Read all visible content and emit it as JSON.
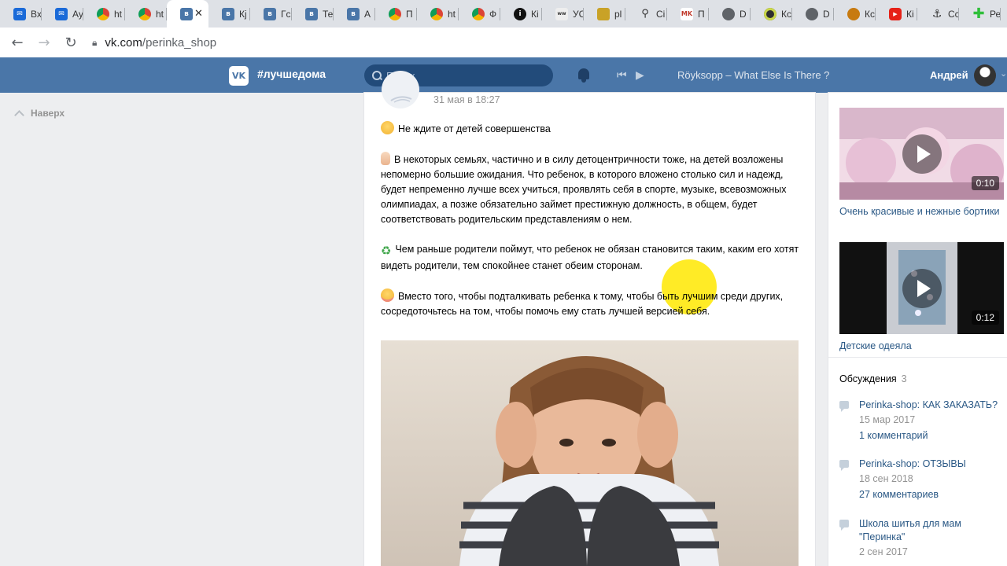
{
  "browser": {
    "tabs": [
      {
        "icon": "mail-icon",
        "title": "Вх",
        "color": "#1a6ad8"
      },
      {
        "icon": "mail-icon",
        "title": "Ау",
        "color": "#1a6ad8"
      },
      {
        "icon": "chrome-icon",
        "title": "ht",
        "color": "#e8a33d"
      },
      {
        "icon": "chrome-icon",
        "title": "ht",
        "color": "#e8a33d"
      },
      {
        "icon": "vk-icon",
        "title": "",
        "color": "#4a76a8",
        "active": true
      },
      {
        "icon": "vk-icon",
        "title": "Кј",
        "color": "#4a76a8"
      },
      {
        "icon": "vk-icon",
        "title": "Гс",
        "color": "#4a76a8"
      },
      {
        "icon": "vk-icon",
        "title": "Те",
        "color": "#4a76a8"
      },
      {
        "icon": "vk-icon",
        "title": "А",
        "color": "#4a76a8"
      },
      {
        "icon": "chrome-icon",
        "title": "П",
        "color": "#e8a33d"
      },
      {
        "icon": "chrome-icon",
        "title": "ht",
        "color": "#e8a33d"
      },
      {
        "icon": "chrome-icon",
        "title": "Ф",
        "color": "#e8a33d"
      },
      {
        "icon": "info-icon",
        "title": "Кі",
        "color": "#111111"
      },
      {
        "icon": "site-icon",
        "title": "УС",
        "color": "#555555"
      },
      {
        "icon": "site-icon",
        "title": "pl",
        "color": "#c9a227"
      },
      {
        "icon": "search-icon",
        "title": "Сі",
        "color": "#333333"
      },
      {
        "icon": "site-icon",
        "title": "П",
        "color": "#c0392b"
      },
      {
        "icon": "globe-icon",
        "title": "D",
        "color": "#5f6368"
      },
      {
        "icon": "site-icon",
        "title": "Кс",
        "color": "#2f2f2f"
      },
      {
        "icon": "globe-icon",
        "title": "D",
        "color": "#5f6368"
      },
      {
        "icon": "site-icon",
        "title": "Кс",
        "color": "#c77a10"
      },
      {
        "icon": "youtube-icon",
        "title": "Кі",
        "color": "#e62117"
      },
      {
        "icon": "anchor-icon",
        "title": "Сс",
        "color": "#333333"
      },
      {
        "icon": "plus-icon",
        "title": "Ре",
        "color": "#2fbf3a"
      }
    ],
    "active_close": "✕",
    "url_host": "vk.com",
    "url_path": "/perinka_shop"
  },
  "vk_header": {
    "logo": "VK",
    "hashtag": "#лучшедома",
    "search_placeholder": "Поиск",
    "track": "Röyksopp – What Else Is There ?",
    "user_name": "Андрей"
  },
  "left": {
    "back_to_top": "Наверх"
  },
  "post": {
    "date": "31 мая в 18:27",
    "paragraphs": [
      {
        "emoji": "face",
        "text": "Не ждите от детей совершенства"
      },
      {
        "emoji": "hand",
        "text": "В некоторых семьях, частично и в силу детоцентричности тоже, на детей возложены непомерно большие ожидания. Что ребенок, в которого вложено столько сил и надежд, будет непременно лучше всех учиться, проявлять себя в спорте, музыке, всевозможных олимпиадах, а позже обязательно займет престижную должность, в общем, будет соответствовать родительским представлениям о нем."
      },
      {
        "emoji": "recycle",
        "text": "Чем раньше родители поймут, что ребенок не обязан становится таким, каким его хотят видеть родители, тем спокойнее станет обеим сторонам."
      },
      {
        "emoji": "flushed",
        "text": "Вместо того, чтобы подталкивать ребенка к тому, чтобы быть лучшим среди других, сосредоточьтесь на том, чтобы помочь ему стать лучшей версией себя."
      }
    ]
  },
  "sidebar": {
    "videos": [
      {
        "duration": "0:10",
        "title": "Очень красивые и нежные бортики"
      },
      {
        "duration": "0:12",
        "title": "Детские одеяла"
      }
    ],
    "discussions_label": "Обсуждения",
    "discussions_count": "3",
    "topics": [
      {
        "title": "Perinka-shop: КАК ЗАКАЗАТЬ?",
        "date": "15 мар 2017",
        "comments": "1 комментарий"
      },
      {
        "title": "Perinka-shop: ОТЗЫВЫ",
        "date": "18 сен 2018",
        "comments": "27 комментариев"
      },
      {
        "title": "Школа шитья для мам \"Перинка\"",
        "date": "2 сен 2017",
        "comments": ""
      }
    ]
  }
}
